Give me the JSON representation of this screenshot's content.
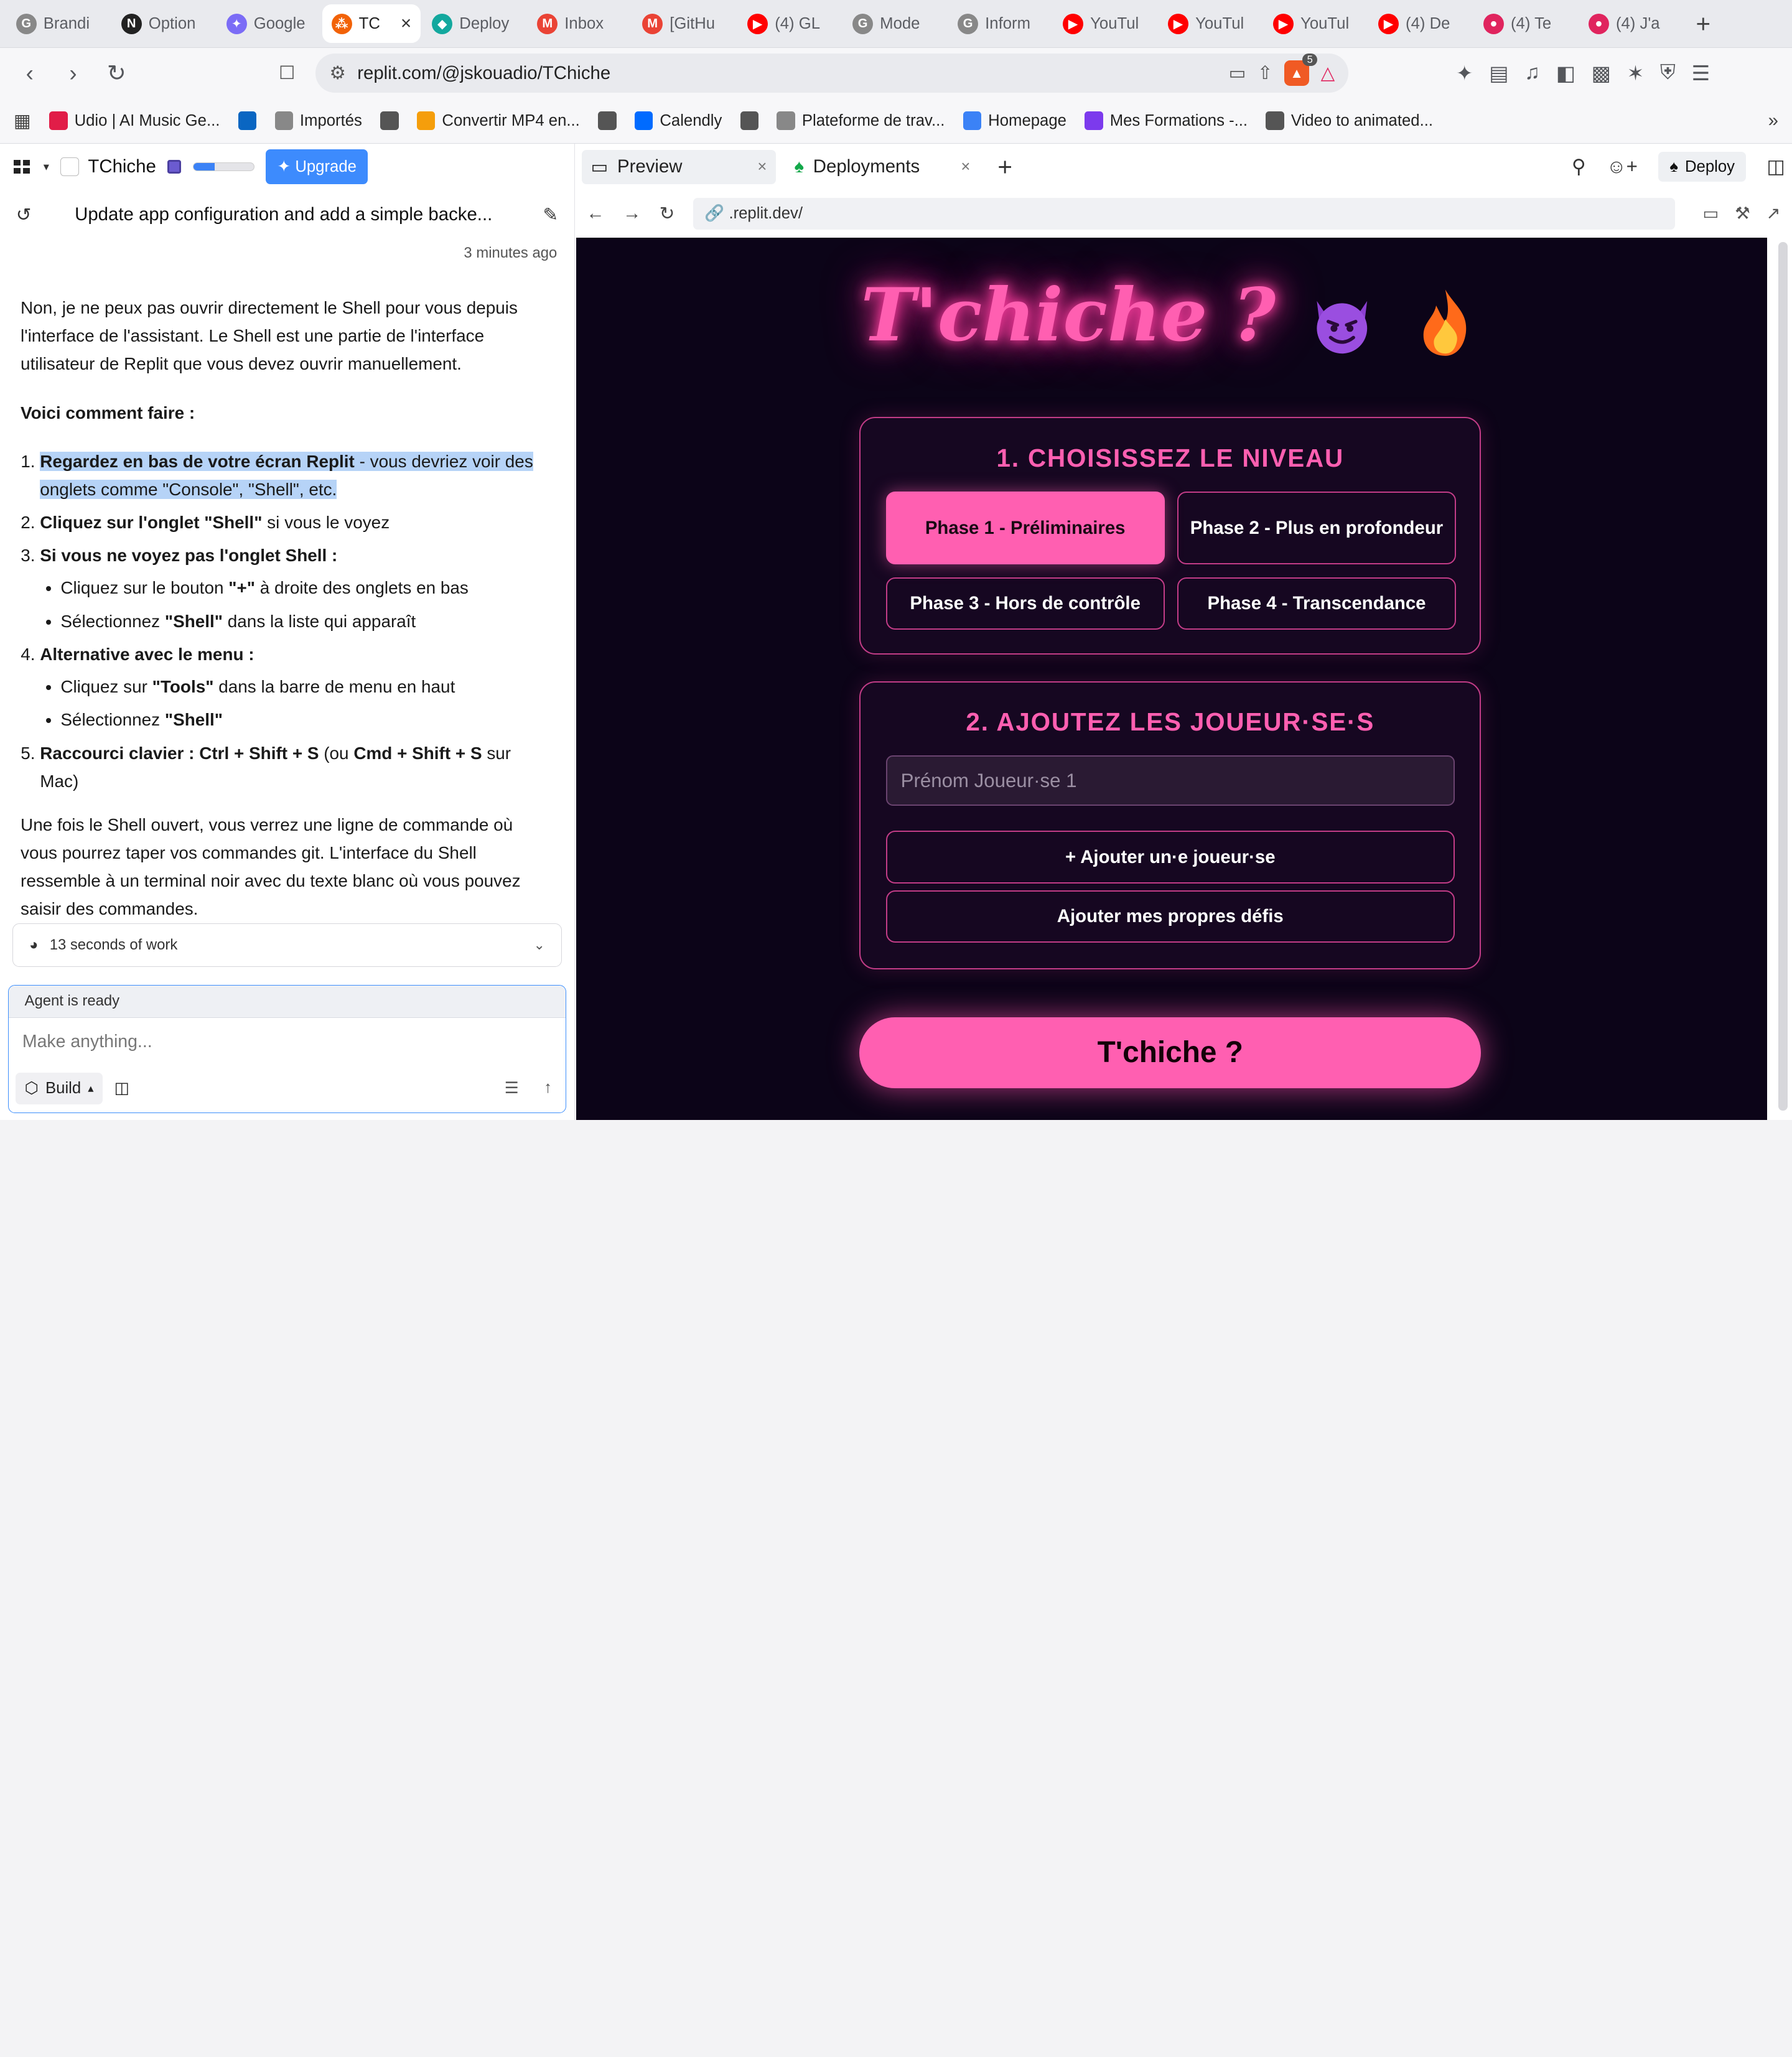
{
  "browser": {
    "tabs": [
      {
        "label": "Brandi",
        "icon": "google-icon",
        "color": "#888"
      },
      {
        "label": "Option",
        "icon": "notion-icon",
        "color": "#222"
      },
      {
        "label": "Google",
        "icon": "gemini-icon",
        "color": "#7b6cf6"
      },
      {
        "label": "TC",
        "icon": "replit-icon",
        "color": "#f26207",
        "active": true
      },
      {
        "label": "Deploy",
        "icon": "diamond-icon",
        "color": "#13a89e"
      },
      {
        "label": "Inbox",
        "icon": "gmail-icon",
        "color": "#ea4335"
      },
      {
        "label": "[GitHu",
        "icon": "gmail-icon",
        "color": "#ea4335"
      },
      {
        "label": "(4) GL",
        "icon": "youtube-icon",
        "color": "#ff0000"
      },
      {
        "label": "Mode",
        "icon": "google-icon",
        "color": "#888"
      },
      {
        "label": "Inform",
        "icon": "google-icon",
        "color": "#888"
      },
      {
        "label": "YouTul",
        "icon": "youtube-icon",
        "color": "#ff0000"
      },
      {
        "label": "YouTul",
        "icon": "youtube-icon",
        "color": "#ff0000"
      },
      {
        "label": "YouTul",
        "icon": "youtube-icon",
        "color": "#ff0000"
      },
      {
        "label": "(4) De",
        "icon": "youtube-icon",
        "color": "#ff0000"
      },
      {
        "label": "(4) Te",
        "icon": "youtube-rec-icon",
        "color": "#e0245e"
      },
      {
        "label": "(4) J'a",
        "icon": "youtube-rec-icon",
        "color": "#e0245e"
      }
    ],
    "new_tab": "+",
    "url": "replit.com/@jskouadio/TChiche",
    "shield_count": "5",
    "bookmarks": [
      {
        "label": "Udio | AI Music Ge...",
        "icon": "udio-icon",
        "color": "#e11d48"
      },
      {
        "label": "",
        "icon": "linkedin-icon",
        "color": "#0a66c2"
      },
      {
        "label": "Importés",
        "icon": "folder-icon",
        "color": "#888"
      },
      {
        "label": "",
        "icon": "globe-icon",
        "color": "#555"
      },
      {
        "label": "Convertir MP4 en...",
        "icon": "converter-icon",
        "color": "#f59e0b"
      },
      {
        "label": "",
        "icon": "globe-icon",
        "color": "#555"
      },
      {
        "label": "Calendly",
        "icon": "calendly-icon",
        "color": "#006bff"
      },
      {
        "label": "",
        "icon": "globe-icon",
        "color": "#555"
      },
      {
        "label": "Plateforme de trav...",
        "icon": "folder-icon",
        "color": "#888"
      },
      {
        "label": "Homepage",
        "icon": "play-icon",
        "color": "#3b82f6"
      },
      {
        "label": "Mes Formations -...",
        "icon": "course-icon",
        "color": "#7c3aed"
      },
      {
        "label": "Video to animated...",
        "icon": "video-icon",
        "color": "#555"
      }
    ]
  },
  "replit": {
    "project_name": "TChiche",
    "upgrade_label": "Upgrade",
    "usage_fraction": 0.35,
    "thread_title": "Update app configuration and add a simple backe...",
    "timestamp": "3 minutes ago",
    "message": {
      "intro": "Non, je ne peux pas ouvrir directement le Shell pour vous depuis l'interface de l'assistant. Le Shell est une partie de l'interface utilisateur de Replit que vous devez ouvrir manuellement.",
      "howto": "Voici comment faire :",
      "step1_bold": "Regardez en bas de votre écran Replit",
      "step1_rest": " - vous devriez voir des onglets comme \"Console\", \"Shell\", etc.",
      "step2_bold": "Cliquez sur l'onglet \"Shell\"",
      "step2_rest": " si vous le voyez",
      "step3_bold": "Si vous ne voyez pas l'onglet Shell :",
      "step3_a_pre": "Cliquez sur le bouton ",
      "step3_a_bold": "\"+\"",
      "step3_a_post": " à droite des onglets en bas",
      "step3_b_pre": "Sélectionnez ",
      "step3_b_bold": "\"Shell\"",
      "step3_b_post": " dans la liste qui apparaît",
      "step4_bold": "Alternative avec le menu :",
      "step4_a_pre": "Cliquez sur ",
      "step4_a_bold": "\"Tools\"",
      "step4_a_post": " dans la barre de menu en haut",
      "step4_b_pre": "Sélectionnez ",
      "step4_b_bold": "\"Shell\"",
      "step5_bold": "Raccourci clavier : Ctrl + Shift + S",
      "step5_mid": " (ou ",
      "step5_bold2": "Cmd + Shift + S",
      "step5_post": " sur Mac)",
      "outro": "Une fois le Shell ouvert, vous verrez une ligne de commande où vous pourrez taper vos commandes git. L'interface du Shell ressemble à un terminal noir avec du texte blanc où vous pouvez saisir des commandes."
    },
    "work_summary": "13 seconds of work",
    "agent_status": "Agent is ready",
    "agent_placeholder": "Make anything...",
    "build_label": "Build",
    "right_tabs": {
      "preview": "Preview",
      "deployments": "Deployments"
    },
    "deploy_label": "Deploy",
    "preview_url": ".replit.dev/"
  },
  "app": {
    "title": "T'chiche ?",
    "section1_title": "1. CHOISISSEZ LE NIVEAU",
    "levels": [
      {
        "label": "Phase 1 - Préliminaires",
        "selected": true
      },
      {
        "label": "Phase 2 - Plus en profondeur",
        "selected": false
      },
      {
        "label": "Phase 3 - Hors de contrôle",
        "selected": false
      },
      {
        "label": "Phase 4 - Transcendance",
        "selected": false
      }
    ],
    "section2_title": "2. AJOUTEZ LES JOUEUR·SE·S",
    "player_placeholder": "Prénom Joueur·se 1",
    "add_player_label": "+ Ajouter un·e joueur·se",
    "add_challenges_label": "Ajouter mes propres défis",
    "start_label": "T'chiche ?"
  }
}
